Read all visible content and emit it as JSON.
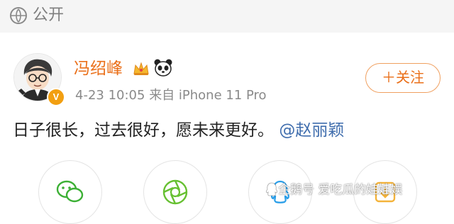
{
  "visibility": {
    "icon": "eye-icon",
    "label": "公开"
  },
  "post": {
    "author": {
      "name": "冯绍峰",
      "avatar_icon": "avatar-cartoon",
      "badge_label": "V",
      "badges": [
        "crown-icon",
        "panda-icon"
      ]
    },
    "timestamp": "4-23 10:05",
    "source": "来自 iPhone 11 Pro",
    "follow_label": "＋关注",
    "text": "日子很长，过去很好，愿未来更好。",
    "mention": "@赵丽颖"
  },
  "share_targets": [
    {
      "name": "wechat",
      "icon": "wechat-icon",
      "color": "#3cb035"
    },
    {
      "name": "moments",
      "icon": "moments-icon",
      "color": "#66c031"
    },
    {
      "name": "qq",
      "icon": "qq-icon",
      "color": "#2a9ee8"
    },
    {
      "name": "qzone",
      "icon": "qzone-icon",
      "color": "#f4b33a"
    }
  ],
  "watermark": "企鹅号 爱吃瓜的娃娃娱",
  "colors": {
    "accent": "#ea6f19",
    "link": "#3f6dad",
    "meta": "#8a8a8a"
  }
}
